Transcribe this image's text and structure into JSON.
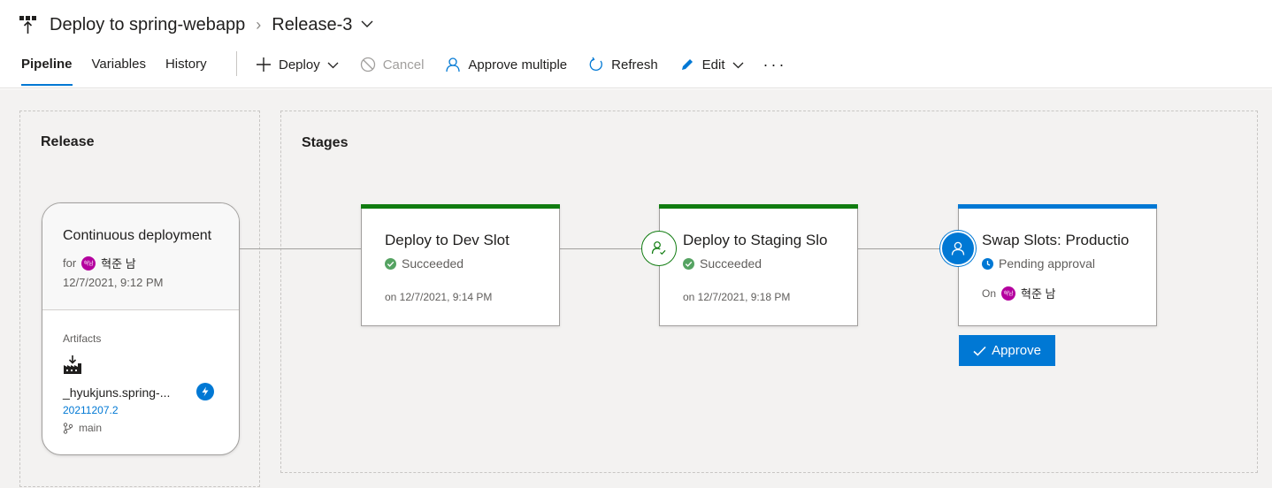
{
  "header": {
    "pipeline_name": "Deploy to spring-webapp",
    "release_name": "Release-3"
  },
  "tabs": [
    {
      "label": "Pipeline",
      "active": true
    },
    {
      "label": "Variables",
      "active": false
    },
    {
      "label": "History",
      "active": false
    }
  ],
  "toolbar": {
    "deploy": "Deploy",
    "cancel": "Cancel",
    "approve_multiple": "Approve multiple",
    "refresh": "Refresh",
    "edit": "Edit",
    "more": "···"
  },
  "release_panel": {
    "title": "Release",
    "card": {
      "trigger": "Continuous deployment",
      "for_label": "for",
      "avatar_initials": "혁남",
      "user": "혁준 남",
      "date": "12/7/2021, 9:12 PM",
      "artifacts_label": "Artifacts",
      "artifact_name": "_hyukjuns.spring-...",
      "artifact_version": "20211207.2",
      "branch": "main"
    }
  },
  "stages_panel": {
    "title": "Stages",
    "stages": [
      {
        "name": "Deploy to Dev Slot",
        "status": "Succeeded",
        "date": "on 12/7/2021, 9:14 PM",
        "color": "#107c10"
      },
      {
        "name": "Deploy to Staging Slo",
        "status": "Succeeded",
        "date": "on 12/7/2021, 9:18 PM",
        "color": "#107c10"
      },
      {
        "name": "Swap Slots: Productio",
        "status": "Pending approval",
        "on_label": "On",
        "avatar_initials": "혁남",
        "user": "혁준 남",
        "color": "#0078d4"
      }
    ],
    "approve_button": "Approve"
  },
  "colors": {
    "accent": "#0078d4",
    "success": "#107c10",
    "avatar": "#b4009e"
  }
}
